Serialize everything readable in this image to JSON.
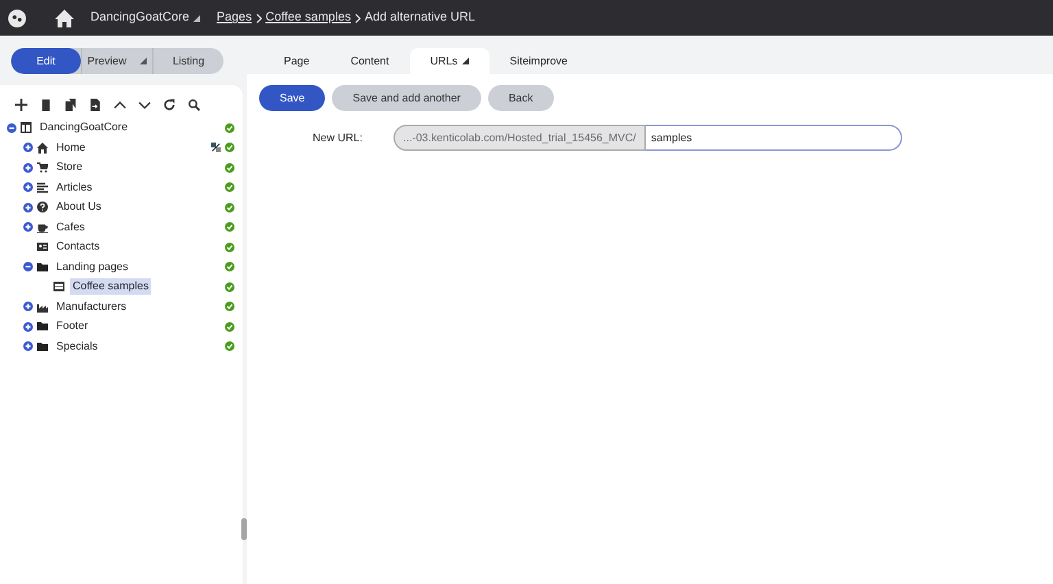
{
  "header": {
    "site": "DancingGoatCore",
    "breadcrumbs": [
      {
        "label": "Pages",
        "link": true
      },
      {
        "label": "Coffee samples",
        "link": true
      },
      {
        "label": "Add alternative URL",
        "link": false
      }
    ]
  },
  "modes": [
    {
      "label": "Edit",
      "selected": true,
      "menu": false
    },
    {
      "label": "Preview",
      "selected": false,
      "menu": true
    },
    {
      "label": "Listing",
      "selected": false,
      "menu": false
    }
  ],
  "tabs": [
    {
      "label": "Page",
      "selected": false,
      "menu": false
    },
    {
      "label": "Content",
      "selected": false,
      "menu": false
    },
    {
      "label": "URLs",
      "selected": true,
      "menu": true
    },
    {
      "label": "Siteimprove",
      "selected": false,
      "menu": false
    }
  ],
  "tree": [
    {
      "label": "DancingGoatCore",
      "kind": "site",
      "expanded": true,
      "selected": false,
      "published": true,
      "extra_icon": false,
      "children": [
        {
          "label": "Home",
          "kind": "home",
          "expanded": false,
          "selected": false,
          "published": true,
          "extra_icon": true
        },
        {
          "label": "Store",
          "kind": "store",
          "expanded": false,
          "selected": false,
          "published": true,
          "extra_icon": false
        },
        {
          "label": "Articles",
          "kind": "articles",
          "expanded": false,
          "selected": false,
          "published": true,
          "extra_icon": false
        },
        {
          "label": "About Us",
          "kind": "about",
          "expanded": false,
          "selected": false,
          "published": true,
          "extra_icon": false
        },
        {
          "label": "Cafes",
          "kind": "cafe",
          "expanded": false,
          "selected": false,
          "published": true,
          "extra_icon": false
        },
        {
          "label": "Contacts",
          "kind": "contacts",
          "selected": false,
          "published": true,
          "extra_icon": false
        },
        {
          "label": "Landing pages",
          "kind": "folder",
          "expanded": true,
          "selected": false,
          "published": true,
          "extra_icon": false,
          "children": [
            {
              "label": "Coffee samples",
              "kind": "page",
              "selected": true,
              "published": true,
              "extra_icon": false
            }
          ]
        },
        {
          "label": "Manufacturers",
          "kind": "factory",
          "expanded": false,
          "selected": false,
          "published": true,
          "extra_icon": false
        },
        {
          "label": "Footer",
          "kind": "folder",
          "expanded": false,
          "selected": false,
          "published": true,
          "extra_icon": false
        },
        {
          "label": "Specials",
          "kind": "folder",
          "expanded": false,
          "selected": false,
          "published": true,
          "extra_icon": false
        }
      ]
    }
  ],
  "actions": [
    {
      "label": "Save",
      "kind": "primary"
    },
    {
      "label": "Save and add another",
      "kind": "secondary"
    },
    {
      "label": "Back",
      "kind": "secondary"
    }
  ],
  "form": {
    "label": "New URL:",
    "prefix": "...-03.kenticolab.com/Hosted_trial_15456_MVC/",
    "value": "samples"
  }
}
